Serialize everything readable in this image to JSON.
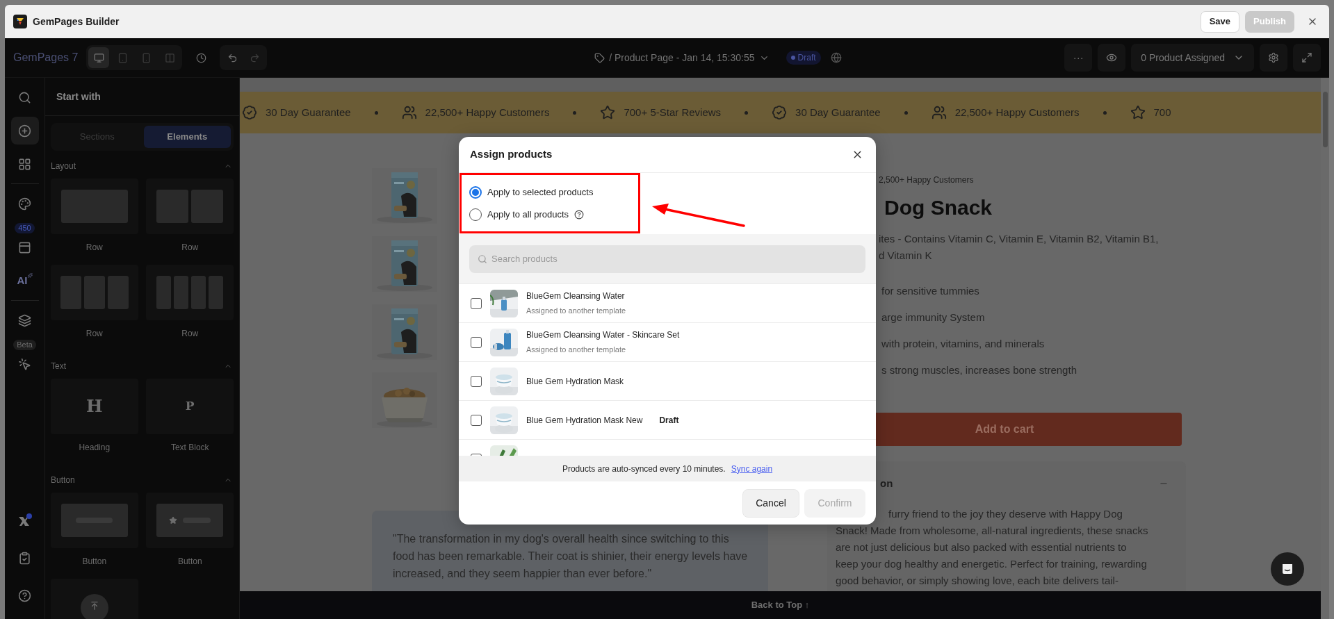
{
  "app": {
    "title": "GemPages Builder",
    "save": "Save",
    "publish": "Publish"
  },
  "toolbar": {
    "brand": "GemPages 7",
    "devices": [
      {
        "kind": "desktop",
        "selected": true
      },
      {
        "kind": "tablet",
        "selected": false
      },
      {
        "kind": "mobile",
        "selected": false
      },
      {
        "kind": "split",
        "selected": false
      }
    ],
    "page_title": "/ Product Page - Jan 14, 15:30:55",
    "status": "Draft",
    "more": "···",
    "assigned": "0 Product Assigned"
  },
  "rail": {
    "top": [
      {
        "kind": "search",
        "selected": false
      },
      {
        "kind": "add",
        "selected": true
      },
      {
        "kind": "apps",
        "selected": false
      },
      {
        "kind": "divider"
      },
      {
        "kind": "theme",
        "selected": false
      },
      {
        "kind": "layout",
        "badge": "450",
        "selected": false
      },
      {
        "kind": "ai",
        "label": "AI",
        "selected": false
      },
      {
        "kind": "divider"
      },
      {
        "kind": "layers",
        "selected": false
      },
      {
        "kind": "cursor",
        "badge": "Beta",
        "selected": false
      }
    ],
    "bottom": [
      {
        "kind": "xlogo",
        "selected": false
      },
      {
        "kind": "checklist",
        "selected": false
      },
      {
        "kind": "help",
        "selected": false
      }
    ]
  },
  "panel": {
    "title": "Start with",
    "tabs": [
      {
        "label": "Sections",
        "selected": false
      },
      {
        "label": "Elements",
        "selected": true
      }
    ],
    "groups": [
      {
        "title": "Layout",
        "expanded": true,
        "items": [
          {
            "kind": "cols1",
            "label": "Row"
          },
          {
            "kind": "cols2",
            "label": "Row"
          },
          {
            "kind": "cols3",
            "label": "Row"
          },
          {
            "kind": "cols4",
            "label": "Row"
          }
        ]
      },
      {
        "title": "Text",
        "expanded": true,
        "items": [
          {
            "kind": "glyph",
            "glyph": "H",
            "label": "Heading"
          },
          {
            "kind": "glyph",
            "glyph": "P",
            "label": "Text Block"
          }
        ]
      },
      {
        "title": "Button",
        "expanded": true,
        "items": [
          {
            "kind": "button",
            "label": "Button"
          },
          {
            "kind": "button-star",
            "label": "Button"
          },
          {
            "kind": "back-top"
          }
        ]
      }
    ]
  },
  "announcement": [
    {
      "kind": "guarantee",
      "text": "30 Day Guarantee"
    },
    {
      "kind": "customers",
      "text": "22,500+ Happy Customers"
    },
    {
      "kind": "reviews",
      "text": "700+ 5-Star Reviews"
    },
    {
      "kind": "guarantee",
      "text": "30 Day Guarantee"
    },
    {
      "kind": "customers",
      "text": "22,500+ Happy Customers"
    },
    {
      "kind": "reviews",
      "text": "700"
    }
  ],
  "product": {
    "rating_text": "2,500+ Happy Customers",
    "title": "Dog Snack",
    "subtitle_lines": [
      "ites - Contains Vitamin C, Vitamin E, Vitamin B2, Vitamin B1,",
      "d Vitamin K"
    ],
    "benefits": [
      "for sensitive tummies",
      "arge immunity System",
      "with protein, vitamins, and minerals",
      "s strong muscles, increases bone strength"
    ],
    "add_to_cart": "Add to cart",
    "description": {
      "title": "on",
      "expanded": true,
      "first_line": "furry friend to the joy they deserve with Happy Dog",
      "lines": [
        "Snack! Made from wholesome, all-natural ingredients, these snacks",
        "are not just delicious but also packed with essential nutrients to",
        "keep your dog healthy and energetic. Perfect for training, rewarding",
        "good behavior, or simply showing love, each bite delivers tail-"
      ]
    }
  },
  "gallery": [
    {
      "kind": "bag"
    },
    {
      "kind": "bag"
    },
    {
      "kind": "bag"
    },
    {
      "kind": "bowl"
    }
  ],
  "testimonial": [
    "\"The transformation in my dog's overall health since switching to this",
    "food has been remarkable. Their coat is shinier, their energy levels have",
    "increased, and they seem happier than ever before.\""
  ],
  "back_to_top": "Back to Top ↑",
  "modal": {
    "title": "Assign products",
    "options": [
      {
        "label": "Apply to selected products",
        "selected": true,
        "help": false
      },
      {
        "label": "Apply to all products",
        "selected": false,
        "help": true
      }
    ],
    "search": {
      "placeholder": "Search products"
    },
    "products": [
      {
        "name": "BlueGem Cleansing Water",
        "note": "Assigned to another template",
        "checked": false
      },
      {
        "name": "BlueGem Cleansing Water - Skincare Set",
        "note": "Assigned to another template",
        "checked": false
      },
      {
        "name": "Blue Gem Hydration Mask",
        "checked": false
      },
      {
        "name": "Blue Gem Hydration Mask New",
        "badge": "Draft",
        "checked": false
      },
      {
        "checked": false
      }
    ],
    "sync": {
      "text": "Products are auto-synced every 10 minutes.",
      "link": "Sync again"
    },
    "cancel": "Cancel",
    "confirm": "Confirm",
    "confirm_disabled": true
  }
}
